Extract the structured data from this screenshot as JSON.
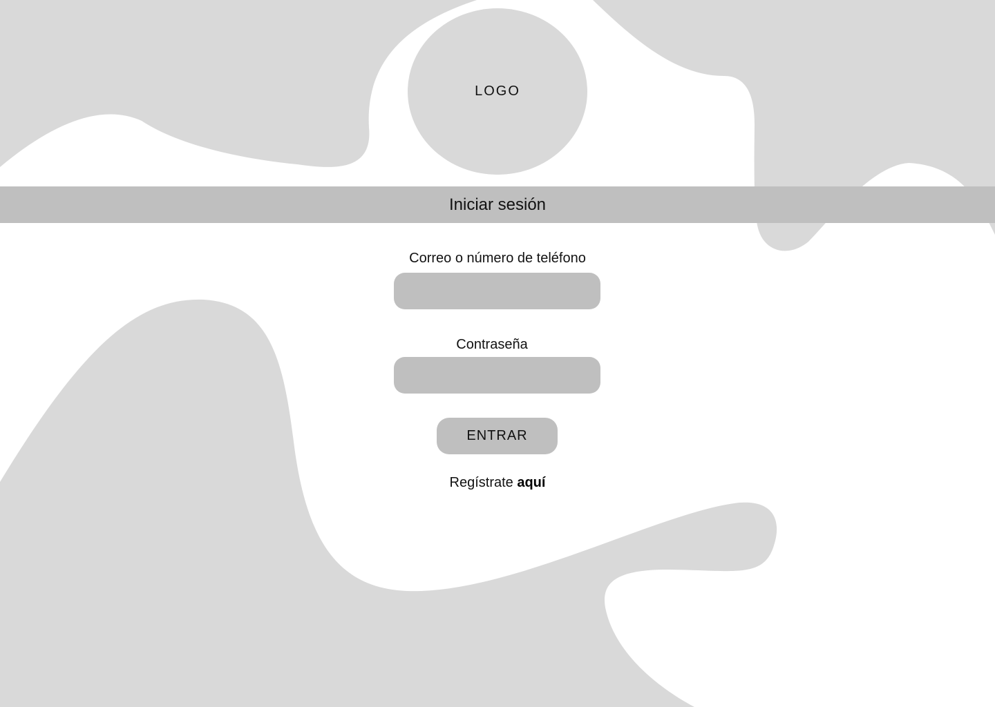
{
  "colors": {
    "background": "#ffffff",
    "blob": "#d9d9d9",
    "field": "#bfbfbf",
    "text": "#111111"
  },
  "logo": {
    "text": "LOGO"
  },
  "header": {
    "title": "Iniciar sesión"
  },
  "form": {
    "email_label": "Correo o número de teléfono",
    "email_value": "",
    "password_label": "Contraseña",
    "password_value": "",
    "submit_label": "ENTRAR"
  },
  "register": {
    "prefix": "Regístrate",
    "link_text": "aquí"
  }
}
